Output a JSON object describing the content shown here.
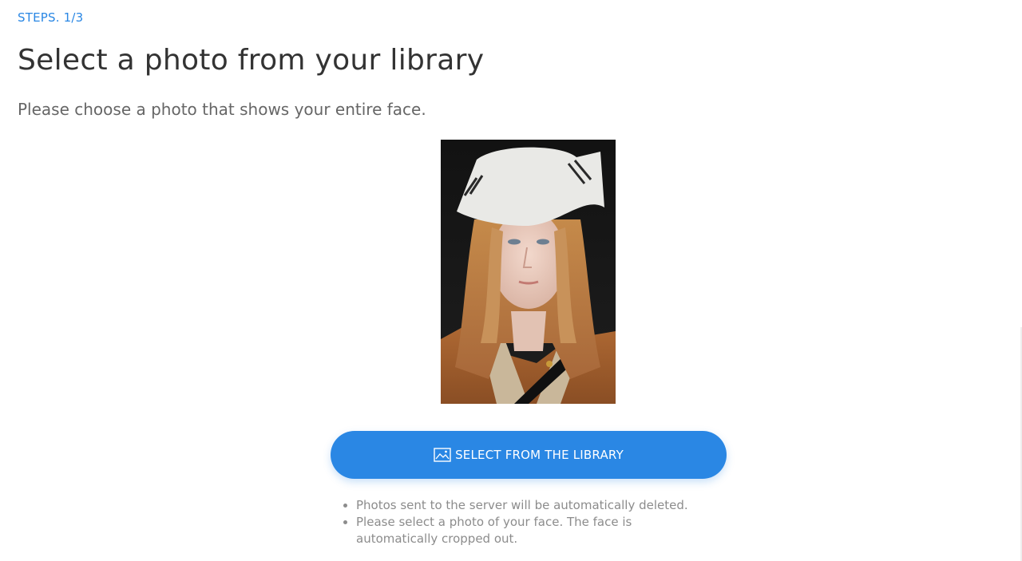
{
  "steps": {
    "label": "STEPS. 1/3"
  },
  "heading": {
    "title": "Select a photo from your library",
    "subtitle": "Please choose a photo that shows your entire face."
  },
  "photo": {
    "kind": "portrait of a person with long strawberry-blonde hair wearing a white headscarf and a tan jacket"
  },
  "select_button": {
    "label": "SELECT FROM THE LIBRARY",
    "icon": "image-icon",
    "color": "#2a87e4"
  },
  "notes": [
    {
      "text": "Photos sent to the server will be automatically deleted."
    },
    {
      "text": "Please select a photo of your face. The face is automatically cropped out."
    }
  ],
  "colors": {
    "accent": "#2a87e4",
    "title": "#333333",
    "subtitle": "#666666",
    "note": "#8c8c8c"
  }
}
